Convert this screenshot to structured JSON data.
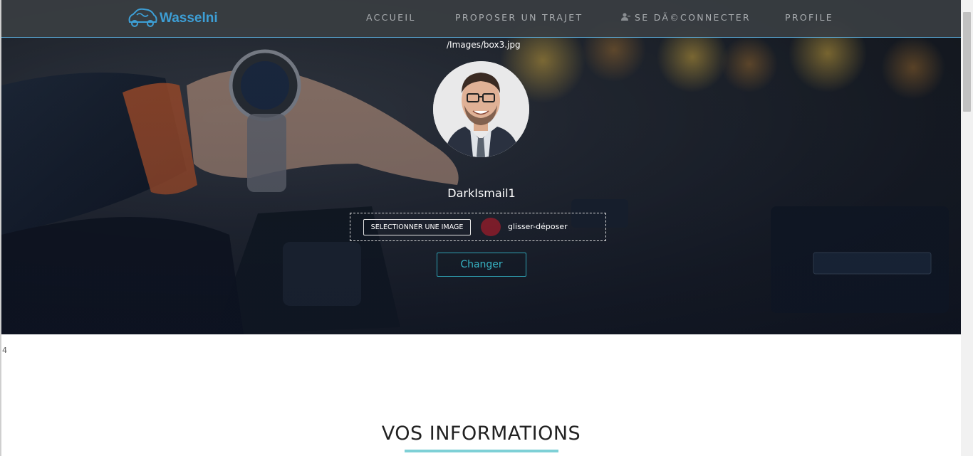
{
  "brand": {
    "name": "Wasselni",
    "color": "#3d9fd6"
  },
  "nav": {
    "items": [
      {
        "label": "ACCUEIL"
      },
      {
        "label": "PROPOSER UN TRAJET"
      },
      {
        "label": "SE DÃ©CONNECTER",
        "icon": "user-icon"
      },
      {
        "label": "PROFILE"
      }
    ]
  },
  "hero": {
    "image_path": "/Images/box3.jpg",
    "username": "DarkIsmail1",
    "dropzone": {
      "select_label": "SELECTIONNER UNE IMAGE",
      "drop_label": "glisser-déposer"
    },
    "change_label": "Changer"
  },
  "stray_count": "4",
  "section": {
    "title": "VOS INFORMATIONS",
    "accent": "#7ed0d6"
  }
}
